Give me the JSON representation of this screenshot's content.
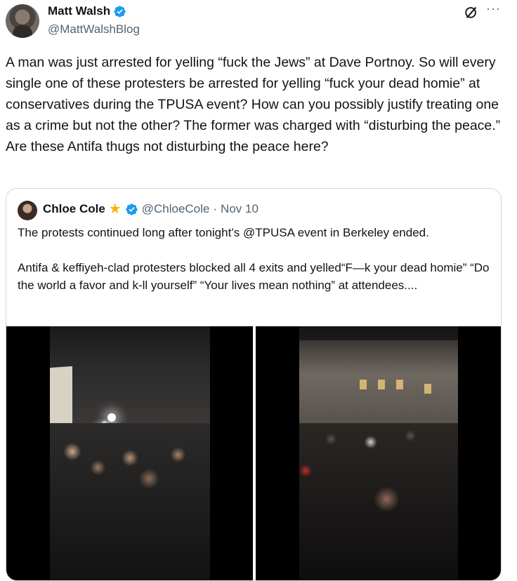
{
  "post": {
    "author_name": "Matt Walsh",
    "author_handle": "@MattWalshBlog",
    "text": "A man was just arrested for yelling “fuck the Jews” at Dave Portnoy. So will every single one of these protesters be arrested for yelling “fuck your dead homie” at conservatives during the TPUSA event? How can you possibly justify treating one as a crime but not the other? The former was charged with “disturbing the peace.” Are these Antifa thugs not disturbing the peace here?",
    "more_label": "···"
  },
  "quote": {
    "author_name": "Chloe Cole",
    "badge_glyph": "★",
    "author_handle": "@ChloeCole",
    "separator": "·",
    "date": "Nov 10",
    "paragraph_1": "The protests continued long after tonight’s @TPUSA event in Berkeley ended.",
    "paragraph_2": "Antifa & keffiyeh-clad protesters blocked all 4 exits and yelled“F—k your dead homie” “Do the world a favor and k-ll yourself” “Your lives mean nothing” at attendees....",
    "media": [
      {
        "kind": "video"
      },
      {
        "kind": "video"
      }
    ]
  },
  "colors": {
    "verified_blue": "#1d9bf0",
    "star_gold": "#f4b400",
    "secondary_text": "#536471",
    "border": "#cfd9de"
  },
  "icons": {
    "grok": "grok-icon",
    "more": "more-icon",
    "verified": "verified-badge-icon",
    "star": "star-icon"
  }
}
